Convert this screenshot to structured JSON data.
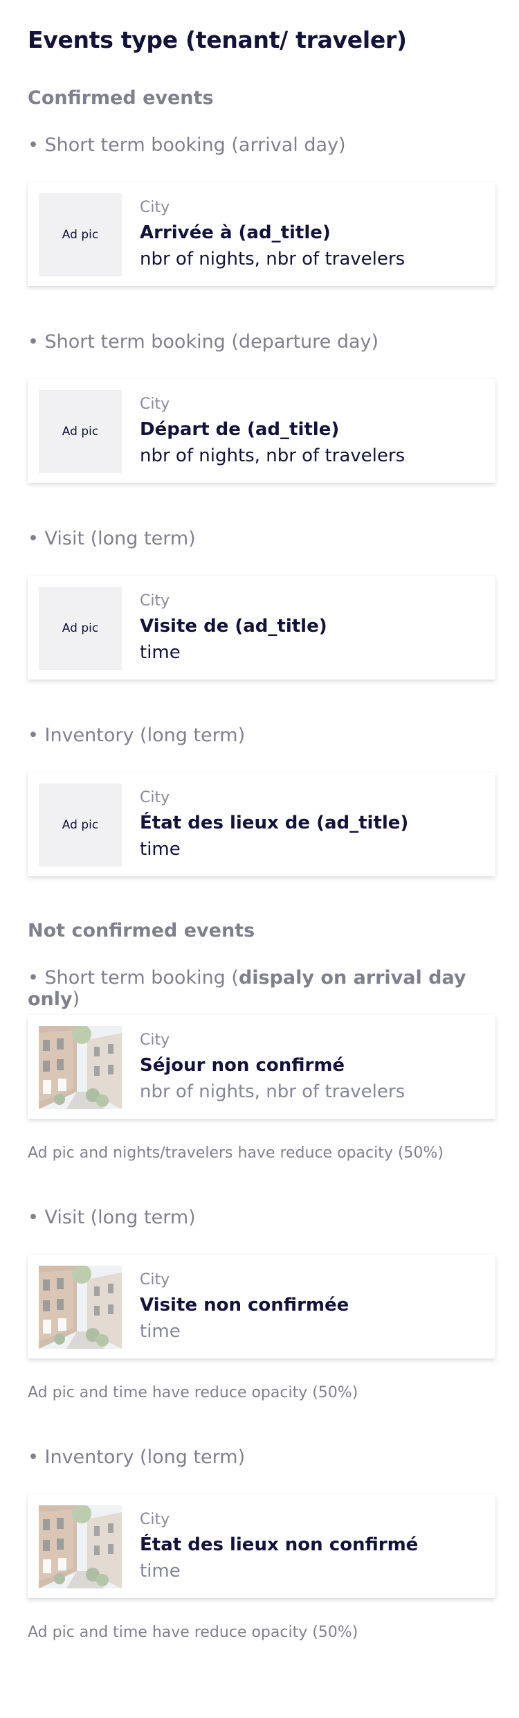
{
  "title": "Events type (tenant/ traveler)",
  "confirmed": {
    "heading": "Confirmed events",
    "items": [
      {
        "bullet": "• Short term booking (arrival day)",
        "pic_label": "Ad pic",
        "city": "City",
        "card_title": "Arrivée à (ad_title)",
        "card_sub": "nbr of nights, nbr of travelers"
      },
      {
        "bullet": "• Short term booking (departure day)",
        "pic_label": "Ad pic",
        "city": "City",
        "card_title": "Départ de (ad_title)",
        "card_sub": "nbr of nights, nbr of travelers"
      },
      {
        "bullet": "• Visit (long term)",
        "pic_label": "Ad pic",
        "city": "City",
        "card_title": "Visite de (ad_title)",
        "card_sub": "time"
      },
      {
        "bullet": "• Inventory (long term)",
        "pic_label": "Ad pic",
        "city": "City",
        "card_title": "État des lieux de (ad_title)",
        "card_sub": "time"
      }
    ]
  },
  "not_confirmed": {
    "heading": "Not confirmed events",
    "items": [
      {
        "bullet_prefix": "• Short term booking (",
        "bullet_bold": "dispaly on arrival day only",
        "bullet_suffix": ")",
        "city": "City",
        "card_title": "Séjour non confirmé",
        "card_sub": "nbr of nights, nbr of travelers",
        "note": "Ad pic and nights/travelers have reduce opacity (50%)"
      },
      {
        "bullet": "• Visit (long term)",
        "city": "City",
        "card_title": "Visite non confirmée",
        "card_sub": "time",
        "note": "Ad pic and time have reduce opacity (50%)"
      },
      {
        "bullet": "• Inventory (long term)",
        "city": "City",
        "card_title": "État des lieux non confirmé",
        "card_sub": "time",
        "note": "Ad pic and time have reduce opacity (50%)"
      }
    ]
  },
  "colors": {
    "primary_text": "#12123a",
    "muted_text": "#80808c",
    "placeholder_bg": "#f1f1f4"
  },
  "icons": {
    "ad_photo": "street-photo-image"
  }
}
